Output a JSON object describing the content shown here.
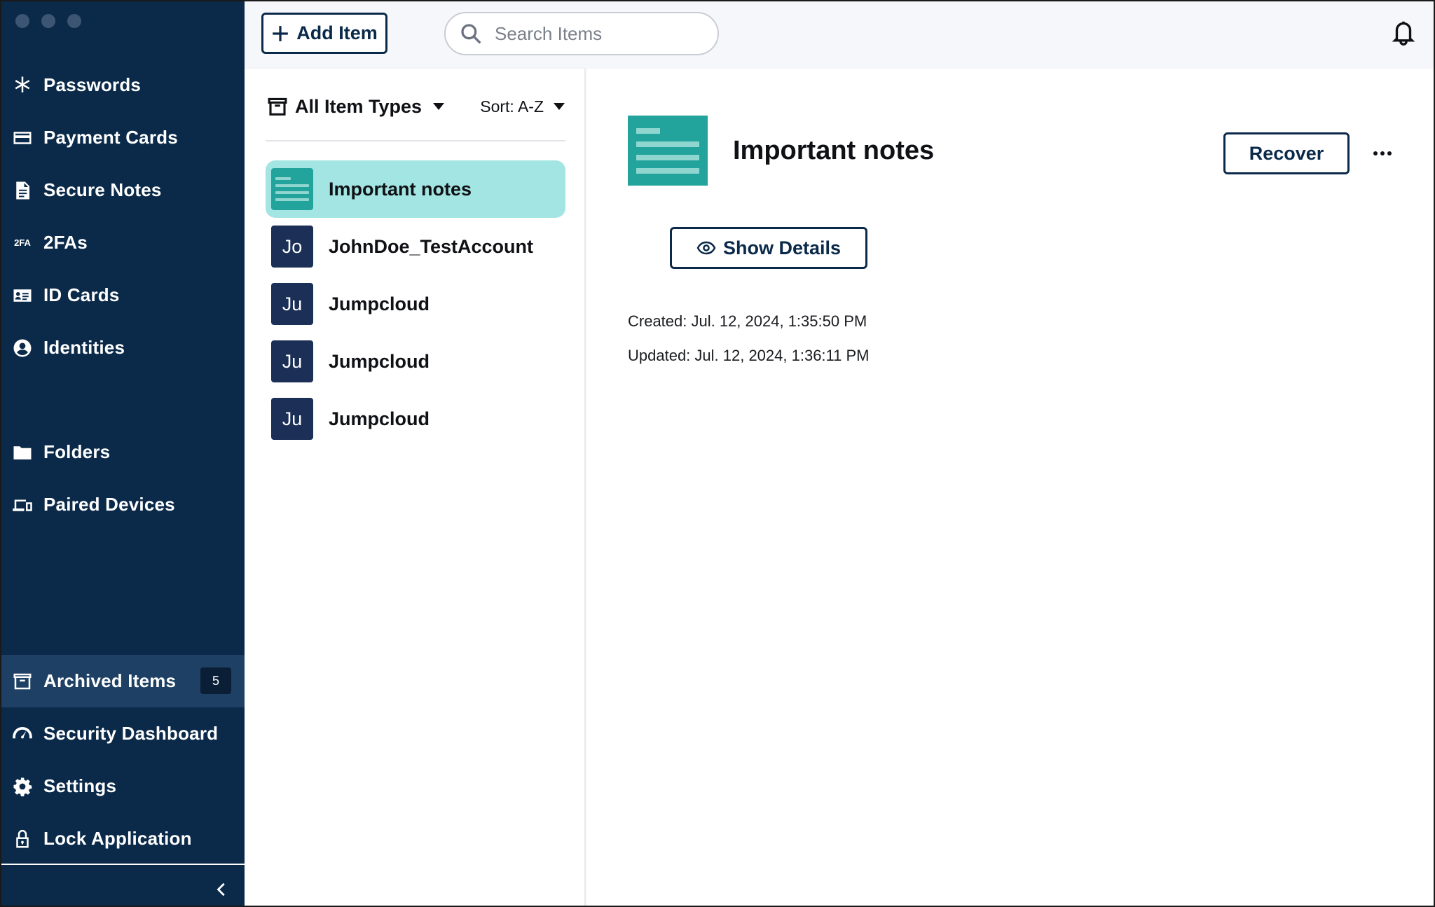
{
  "sidebar": {
    "nav": [
      {
        "label": "Passwords",
        "icon": "asterisk-icon"
      },
      {
        "label": "Payment Cards",
        "icon": "credit-card-icon"
      },
      {
        "label": "Secure Notes",
        "icon": "note-document-icon"
      },
      {
        "label": "2FAs",
        "icon": "two-factor-icon",
        "icon_text": "2FA"
      },
      {
        "label": "ID Cards",
        "icon": "id-card-icon"
      },
      {
        "label": "Identities",
        "icon": "user-circle-icon"
      }
    ],
    "secondary": [
      {
        "label": "Folders",
        "icon": "folder-icon"
      },
      {
        "label": "Paired Devices",
        "icon": "devices-icon"
      }
    ],
    "bottom": [
      {
        "label": "Archived Items",
        "icon": "archive-box-icon",
        "badge": "5",
        "active": true
      },
      {
        "label": "Security Dashboard",
        "icon": "gauge-icon"
      },
      {
        "label": "Settings",
        "icon": "gear-icon"
      },
      {
        "label": "Lock Application",
        "icon": "lock-icon"
      }
    ],
    "colors": {
      "background": "#0b2a4a",
      "active": "#1d4064"
    }
  },
  "toolbar": {
    "add_label": "Add Item",
    "search_placeholder": "Search Items"
  },
  "list": {
    "filter_label": "All Item Types",
    "sort_label": "Sort: A-Z",
    "items": [
      {
        "name": "Important notes",
        "avatar": "",
        "type": "note",
        "selected": true
      },
      {
        "name": "JohnDoe_TestAccount",
        "avatar": "Jo",
        "type": "login"
      },
      {
        "name": "Jumpcloud",
        "avatar": "Ju",
        "type": "login"
      },
      {
        "name": "Jumpcloud",
        "avatar": "Ju",
        "type": "login"
      },
      {
        "name": "Jumpcloud",
        "avatar": "Ju",
        "type": "login"
      }
    ],
    "colors": {
      "selected": "#a2e5e2",
      "avatar": "#1b2f57",
      "note": "#22a39b"
    }
  },
  "detail": {
    "title": "Important notes",
    "recover_label": "Recover",
    "show_details_label": "Show Details",
    "created": "Created: Jul. 12, 2024, 1:35:50 PM",
    "updated": "Updated: Jul. 12, 2024, 1:36:11 PM"
  }
}
